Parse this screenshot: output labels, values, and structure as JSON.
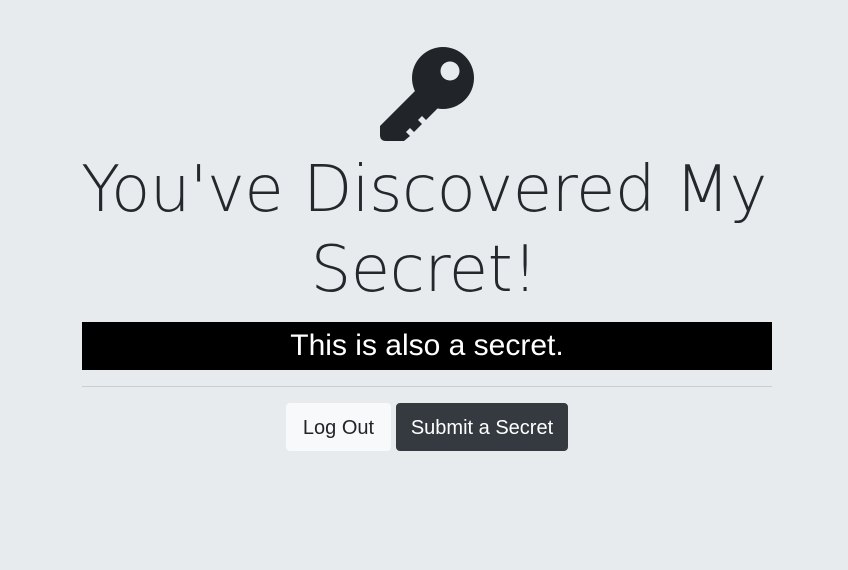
{
  "icon": {
    "name": "key-icon",
    "color": "#212529"
  },
  "heading": {
    "title": "You've Discovered My Secret!"
  },
  "secret": {
    "text": "This is also a secret."
  },
  "actions": {
    "logout_label": "Log Out",
    "submit_label": "Submit a Secret"
  },
  "colors": {
    "background": "#e8ebee",
    "banner": "#000000",
    "logout_button": "#f8f9fa",
    "submit_button": "#343a40"
  }
}
